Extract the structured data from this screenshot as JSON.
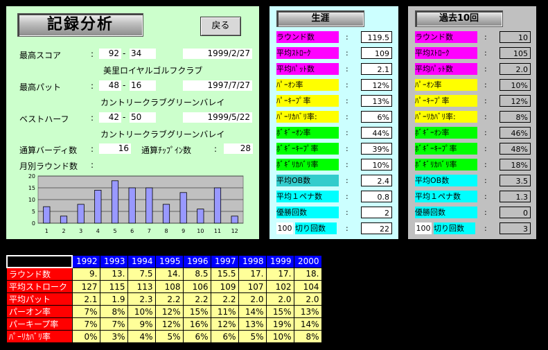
{
  "analysis": {
    "title": "記録分析",
    "back_label": "戻る",
    "best_score": {
      "label": "最高スコア",
      "front": "92",
      "back": "34",
      "date": "1999/2/27",
      "course": "美里ロイヤルゴルフクラブ"
    },
    "best_putt": {
      "label": "最高パット",
      "front": "48",
      "back": "16",
      "date": "1997/7/27",
      "course": "カントリークラブグリーンバレイ"
    },
    "best_half": {
      "label": "ベストハーフ",
      "front": "42",
      "back": "50",
      "date": "1999/5/22",
      "course": "カントリークラブグリーンバレイ"
    },
    "total_birdies_label": "通算バーディ数",
    "total_birdies": "16",
    "total_chipins_label": "通算ﾁｯﾌﾟｲﾝ数",
    "total_chipins": "28",
    "monthly_label": "月別ラウンド数",
    "colon": ":",
    "dash": "-"
  },
  "chart_data": {
    "type": "bar",
    "categories": [
      "1",
      "2",
      "3",
      "4",
      "5",
      "6",
      "7",
      "8",
      "9",
      "10",
      "11",
      "12"
    ],
    "values": [
      7,
      3,
      8,
      14,
      18,
      15,
      15,
      8,
      13,
      6,
      15,
      3
    ],
    "ylim": [
      0,
      20
    ],
    "yticks": [
      "0",
      "5",
      "10",
      "15",
      "20"
    ],
    "grid": true,
    "bar_color": "#9999ff"
  },
  "career": {
    "heading": "生涯",
    "rows": [
      {
        "label": "ラウンド数",
        "value": "119.5",
        "color": "#ff00ff"
      },
      {
        "label": "平均ｽﾄﾛｰｸ",
        "value": "109",
        "color": "#ff00ff"
      },
      {
        "label": "平均ﾊﾟｯﾄ数",
        "value": "2.1",
        "color": "#ff00ff"
      },
      {
        "label": "ﾊﾟｰｵﾝ率",
        "value": "12%",
        "color": "#ffff00"
      },
      {
        "label": "ﾊﾟｰｷｰﾌﾟ率",
        "value": "13%",
        "color": "#ffff00"
      },
      {
        "label": "ﾊﾟｰﾘｶﾊﾞﾘ率:",
        "value": "6%",
        "color": "#ffff00"
      },
      {
        "label": "ﾎﾞｷﾞｰｵﾝ率",
        "value": "44%",
        "color": "#00ff00"
      },
      {
        "label": "ﾎﾞｷﾞｰｷｰﾌﾟ率",
        "value": "39%",
        "color": "#00ff00"
      },
      {
        "label": "ﾎﾞｷﾞﾘｶﾊﾞﾘ率",
        "value": "10%",
        "color": "#00ff00"
      },
      {
        "label": "平均OB数",
        "value": "2.4",
        "color": "#33cccc"
      },
      {
        "label": "平均１ペナ数",
        "value": "0.8",
        "color": "#00ffff"
      },
      {
        "label": "優勝回数",
        "value": "2",
        "color": "#00ffff"
      },
      {
        "label": "切り回数",
        "prefix": "100",
        "value": "22",
        "color": "#00ffff"
      }
    ]
  },
  "recent10": {
    "heading": "過去10回",
    "rows": [
      {
        "label": "ラウンド数",
        "value": "10",
        "color": "#ff00ff"
      },
      {
        "label": "平均ｽﾄﾛｰｸ",
        "value": "105",
        "color": "#ff00ff"
      },
      {
        "label": "平均ﾊﾟｯﾄ数",
        "value": "2.0",
        "color": "#ff00ff"
      },
      {
        "label": "ﾊﾟｰｵﾝ率",
        "value": "10%",
        "color": "#ffff00"
      },
      {
        "label": "ﾊﾟｰｷｰﾌﾟ率",
        "value": "12%",
        "color": "#ffff00"
      },
      {
        "label": "ﾊﾟｰﾘｶﾊﾞﾘ率:",
        "value": "8%",
        "color": "#ffff00"
      },
      {
        "label": "ﾎﾞｷﾞｰｵﾝ率",
        "value": "46%",
        "color": "#00ff00"
      },
      {
        "label": "ﾎﾞｷﾞｰｷｰﾌﾟ率",
        "value": "48%",
        "color": "#00ff00"
      },
      {
        "label": "ﾎﾞｷﾞﾘｶﾊﾞﾘ率",
        "value": "18%",
        "color": "#00ff00"
      },
      {
        "label": "平均OB数",
        "value": "3.5",
        "color": "#00ffff"
      },
      {
        "label": "平均１ペナ数",
        "value": "1.3",
        "color": "#00ffff"
      },
      {
        "label": "優勝回数",
        "value": "0",
        "color": "#00ffff"
      },
      {
        "label": "切り回数",
        "prefix": "100",
        "value": "3",
        "color": "#00ffff"
      }
    ]
  },
  "yearly": {
    "years": [
      "1992",
      "1993",
      "1994",
      "1995",
      "1996",
      "1997",
      "1998",
      "1999",
      "2000"
    ],
    "rows": [
      {
        "label": "ラウンド数",
        "values": [
          "9.",
          "13.",
          "7.5",
          "14.",
          "8.5",
          "15.5",
          "17.",
          "17.",
          "18."
        ]
      },
      {
        "label": "平均ストローク",
        "values": [
          "127",
          "115",
          "113",
          "108",
          "106",
          "109",
          "107",
          "102",
          "104"
        ]
      },
      {
        "label": "平均パット",
        "values": [
          "2.1",
          "1.9",
          "2.3",
          "2.2",
          "2.2",
          "2.2",
          "2.0",
          "2.0",
          "2.0"
        ]
      },
      {
        "label": "パーオン率",
        "values": [
          "7%",
          "8%",
          "10%",
          "12%",
          "15%",
          "11%",
          "14%",
          "15%",
          "13%"
        ]
      },
      {
        "label": "パーキープ率",
        "values": [
          "7%",
          "7%",
          "9%",
          "12%",
          "16%",
          "12%",
          "13%",
          "19%",
          "14%"
        ]
      },
      {
        "label": "ﾊﾟｰﾘｶﾊﾞﾘ率",
        "values": [
          "0%",
          "3%",
          "4%",
          "5%",
          "6%",
          "6%",
          "5%",
          "10%",
          "8%"
        ]
      }
    ]
  }
}
